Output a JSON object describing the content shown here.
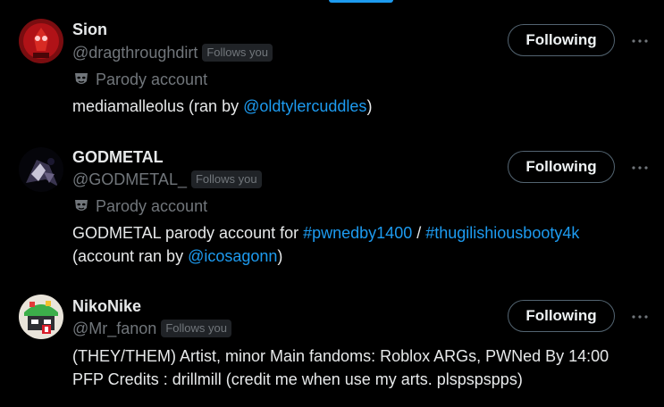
{
  "users": [
    {
      "name": "Sion",
      "handle": "@dragthroughdirt",
      "follows_you": "Follows you",
      "parody": "Parody account",
      "bio": {
        "t1": "mediamalleolus (ran by ",
        "link1": "@oldtylercuddles",
        "t2": ")"
      },
      "follow_label": "Following"
    },
    {
      "name": "GODMETAL",
      "handle": "@GODMETAL_",
      "follows_you": "Follows you",
      "parody": "Parody account",
      "bio": {
        "t1": "GODMETAL parody account for ",
        "link1": "#pwnedby1400",
        "t2": " / ",
        "link2": "#thugilishiousbooty4k",
        "t3": "(account ran by ",
        "link3": "@icosagonn",
        "t4": ")"
      },
      "follow_label": "Following"
    },
    {
      "name": "NikoNike",
      "handle": "@Mr_fanon",
      "follows_you": "Follows you",
      "bio": {
        "line1": "(THEY/THEM) Artist, minor Main fandoms: Roblox ARGs, PWNed By 14:00",
        "line2": "PFP Credits : drillmill (credit me when use my arts. plspspspps)"
      },
      "follow_label": "Following"
    }
  ],
  "colors": {
    "accent": "#1d9bf0",
    "muted": "#71767b",
    "text": "#e7e9ea"
  }
}
